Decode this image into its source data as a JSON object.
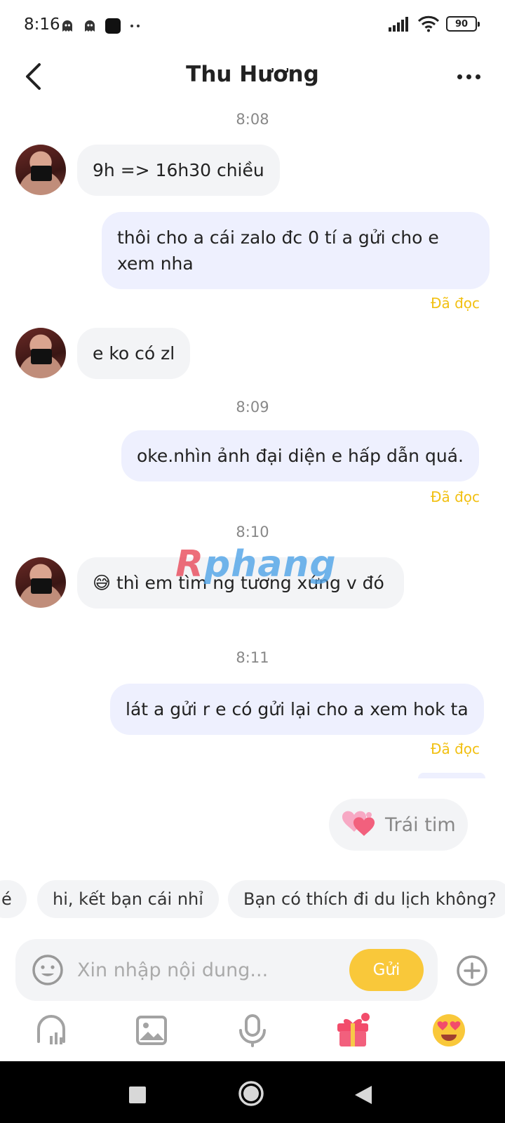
{
  "status_bar": {
    "time": "8:16",
    "battery": "90"
  },
  "header": {
    "title": "Thu Hương"
  },
  "messages": [
    {
      "type": "time",
      "text": "8:08"
    },
    {
      "type": "in",
      "text": "9h => 16h30 chiều"
    },
    {
      "type": "out",
      "text": "thôi cho a cái zalo đc 0 tí a gửi cho e xem nha",
      "status": "Đã đọc"
    },
    {
      "type": "in",
      "text": "e ko có zl"
    },
    {
      "type": "time",
      "text": "8:09"
    },
    {
      "type": "out",
      "text": "oke.nhìn ảnh đại diện e hấp dẫn quá.",
      "status": "Đã đọc"
    },
    {
      "type": "time",
      "text": "8:10"
    },
    {
      "type": "in",
      "text": "😅 thì em tìm ng tương xứng v đó"
    },
    {
      "type": "time",
      "text": "8:11"
    },
    {
      "type": "out",
      "text": "lát a gửi r e có gửi lại cho a xem hok ta",
      "status": "Đã đọc"
    }
  ],
  "watermark": {
    "part1": "R",
    "part2": "phang"
  },
  "suggestion": {
    "label": "Trái tim",
    "icon": "hearts-icon"
  },
  "quick_replies": [
    "é",
    "hi, kết bạn cái nhỉ",
    "Bạn có thích đi du lịch không?"
  ],
  "input": {
    "placeholder": "Xin nhập nội dung...",
    "value": "",
    "send_label": "Gửi"
  },
  "toolbar": {
    "icons": [
      "voice-room-icon",
      "image-icon",
      "microphone-icon",
      "gift-icon",
      "heart-eyes-emoji-icon"
    ]
  },
  "colors": {
    "accent": "#f9c83a",
    "read_status": "#f2c012",
    "outgoing_bubble": "#eef0fe",
    "incoming_bubble": "#f3f4f6"
  }
}
